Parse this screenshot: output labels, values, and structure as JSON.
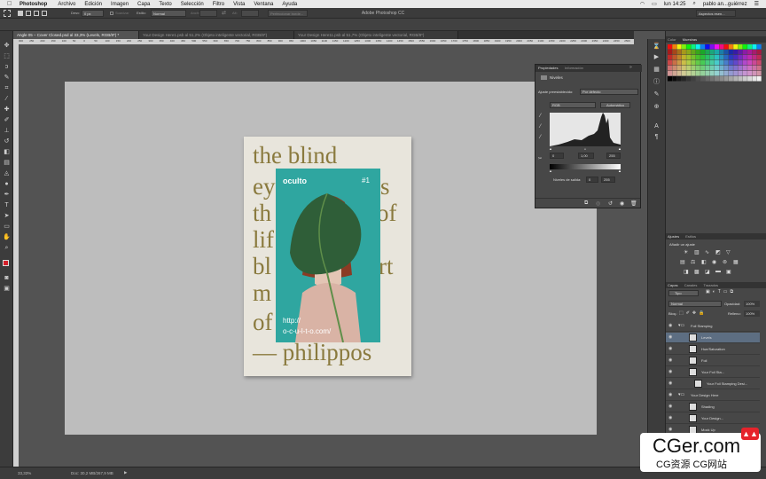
{
  "menubar": {
    "app": "Photoshop",
    "items": [
      "Archivo",
      "Edición",
      "Imagen",
      "Capa",
      "Texto",
      "Selección",
      "Filtro",
      "Vista",
      "Ventana",
      "Ayuda"
    ],
    "clock": "lun 14:25",
    "user": "pablo an...guiérrez"
  },
  "window_title": "Adobe Photoshop CC",
  "options": {
    "feather_label": "Desv:",
    "feather_value": "0 px",
    "smooth_label": "Suavizar",
    "style_label": "Estilo:",
    "style_value": "Normal",
    "width_label": "Anch:",
    "height_label": "Alt:",
    "refine_button": "Perfeccionar borde...",
    "workspace": "Aspectos esen..."
  },
  "tabs": [
    {
      "label": "Angle 05 – Cover Closed.psd al 33,3% (Levels, RGB/8*) *",
      "active": true
    },
    {
      "label": "Your Design Here1.psb al 51,2% (Objeto inteligente vectorial, RGB/8*)",
      "active": false
    },
    {
      "label": "Your Design Here11.psb al 51,7% (Objeto inteligente vectorial, RGB/8*)",
      "active": false
    }
  ],
  "ruler_ticks": [
    "300",
    "250",
    "200",
    "150",
    "100",
    "50",
    "0",
    "50",
    "100",
    "150",
    "200",
    "250",
    "300",
    "350",
    "400",
    "450",
    "500",
    "550",
    "600",
    "650",
    "700",
    "750",
    "800",
    "850",
    "900",
    "950",
    "1000",
    "1050",
    "1100",
    "1150",
    "1200",
    "1250",
    "1300",
    "1350",
    "1400",
    "1450",
    "1500",
    "1550",
    "1600",
    "1650",
    "1700",
    "1750",
    "1800",
    "1850",
    "1900",
    "1950",
    "2000",
    "2050",
    "2100",
    "2150",
    "2200",
    "2250",
    "2300",
    "2350",
    "2400",
    "2450",
    "2500"
  ],
  "poster": {
    "lines": [
      "the blind",
      "ey",
      "th",
      "lif",
      "bl",
      "m",
      "of",
      "— philippos"
    ],
    "lines_right": [
      "s",
      "of",
      "rt"
    ],
    "cover_brand": "oculto",
    "cover_number": "#1",
    "url_line1": "http://",
    "url_line2": "o-c-u-l-t-o.com/"
  },
  "properties": {
    "tab1": "Propiedades",
    "tab2": "Información",
    "title": "Niveles",
    "preset_label": "Ajuste preestablecido:",
    "preset_value": "Por defecto",
    "channel": "RGB",
    "auto_button": "Automático",
    "input_black": "0",
    "input_gamma": "1,00",
    "input_white": "255",
    "output_label": "Niveles de salida:",
    "output_black": "0",
    "output_white": "255"
  },
  "panels": {
    "color_tab": "Color",
    "swatches_tab": "Muestras",
    "adjust_tab": "Ajustes",
    "styles_tab": "Estilos",
    "adjust_add": "Añadir un ajuste",
    "layers_tab": "Capas",
    "channels_tab": "Canales",
    "paths_tab": "Trazados",
    "kind_label": "Tipo",
    "blend_mode": "Normal",
    "opacity_label": "Opacidad:",
    "opacity_value": "100%",
    "lock_label": "Bloq.:",
    "fill_label": "Relleno:",
    "fill_value": "100%"
  },
  "layers": [
    {
      "name": "Foil Stamping",
      "indent": 0,
      "group": true,
      "selected": false
    },
    {
      "name": "Levels",
      "indent": 1,
      "group": false,
      "selected": true
    },
    {
      "name": "Hue/Saturation",
      "indent": 1,
      "group": false,
      "selected": false
    },
    {
      "name": "Foil",
      "indent": 1,
      "group": false,
      "selected": false
    },
    {
      "name": "Your Foil Sta...",
      "indent": 1,
      "group": false,
      "selected": false
    },
    {
      "name": "Your Foil Stamping Desi...",
      "indent": 2,
      "group": false,
      "selected": false
    },
    {
      "name": "Your Design Here",
      "indent": 0,
      "group": true,
      "selected": false
    },
    {
      "name": "Shading",
      "indent": 1,
      "group": false,
      "selected": false
    },
    {
      "name": "Your Design...",
      "indent": 1,
      "group": false,
      "selected": false
    },
    {
      "name": "Mock Up",
      "indent": 1,
      "group": false,
      "selected": false
    }
  ],
  "status": {
    "zoom": "33,33%",
    "doc": "Doc: 30,2 MB/267,9 MB"
  },
  "watermark": {
    "brand": "CGer.com",
    "subtitle": "CG资源 CG网站"
  },
  "colors": {
    "poster_text": "#8a7a3e",
    "cover_teal": "#2fa6a0",
    "foreground": "#d4202a"
  }
}
